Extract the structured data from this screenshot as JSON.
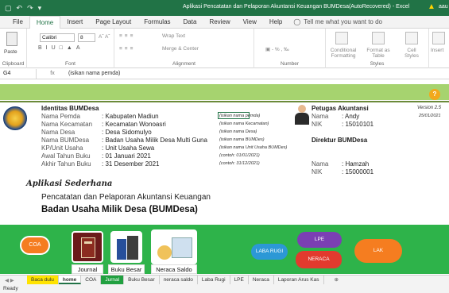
{
  "window": {
    "title": "Aplikasi Pencatatan dan Pelaporan Akuntansi Keuangan BUMDesa(AutoRecovered) - Excel",
    "user": "aau"
  },
  "ribbon_tabs": [
    "File",
    "Home",
    "Insert",
    "Page Layout",
    "Formulas",
    "Data",
    "Review",
    "View",
    "Help"
  ],
  "tell_me": "Tell me what you want to do",
  "ribbon": {
    "paste": "Paste",
    "font_name": "Calibri",
    "font_size": "8",
    "wrap_text": "Wrap Text",
    "merge_center": "Merge & Center",
    "conditional": "Conditional Formatting",
    "format_table": "Format as Table",
    "cell_styles": "Cell Styles",
    "insert": "Insert",
    "groups": [
      "Clipboard",
      "Font",
      "Alignment",
      "Number",
      "Styles"
    ]
  },
  "formula_bar": {
    "cell": "G4",
    "fx": "fx",
    "value": "(isikan nama pemda)"
  },
  "identitas": {
    "heading": "Identitas BUMDesa",
    "rows": [
      {
        "label": "Nama Pemda",
        "value": ": Kabupaten Madiun",
        "hint": "(isikan nama pemda)"
      },
      {
        "label": "Nama Kecamatan",
        "value": ": Kecamatan Wonoasri",
        "hint": "(isikan nama Kecamatan)"
      },
      {
        "label": "Nama Desa",
        "value": ": Desa Sidomulyo",
        "hint": "(isikan nama Desa)"
      },
      {
        "label": "Nama BUMDesa",
        "value": ": Badan Usaha Milik Desa Multi Guna",
        "hint": "(isikan nama BUMDes)"
      },
      {
        "label": "KP/Unit Usaha",
        "value": ": Unit Usaha Sewa",
        "hint": "(isikan nama Unit Usaha BUMDes)"
      },
      {
        "label": "Awal Tahun Buku",
        "value": ": 01 Januari 2021",
        "hint": "(contoh: 01/01/2021)"
      },
      {
        "label": "Akhir Tahun Buku",
        "value": ": 31 Desember 2021",
        "hint": "(contoh: 31/12/2021)"
      }
    ]
  },
  "petugas": {
    "heading": "Petugas Akuntansi",
    "nama_label": "Nama",
    "nama_value": ": Andy",
    "nik_label": "NIK",
    "nik_value": ": 15010101"
  },
  "direktur": {
    "heading": "Direktur BUMDesa",
    "nama_label": "Nama",
    "nama_value": ": Hamzah",
    "nik_label": "NIK",
    "nik_value": ": 15000001"
  },
  "version": {
    "label": "Version 2.5",
    "date": "25/01/2021"
  },
  "help_badge": "?",
  "app": {
    "title": "Aplikasi Sederhana",
    "subtitle1": "Pencatatan dan Pelaporan Akuntansi Keuangan",
    "subtitle2": "Badan Usaha Milik Desa (BUMDesa)"
  },
  "nav": {
    "coa": "COA",
    "journal_icon_text": "Journal",
    "journal": "Journal",
    "buku_besar": "Buku Besar",
    "neraca_saldo": "Neraca Saldo",
    "laba_rugi": "LABA RUGI",
    "lpe": "LPE",
    "neraca": "NERACA",
    "lak": "LAK"
  },
  "sheet_tabs": [
    "Baca dulu",
    "home",
    "COA",
    "Jurnal",
    "Buku Besar",
    "neraca saldo",
    "Laba Rugi",
    "LPE",
    "Neraca",
    "Laporan Arus Kas"
  ],
  "status": "Ready",
  "colors": {
    "excel_green": "#217346",
    "band_green": "#a6d36f",
    "nav_green": "#2eb34a",
    "accent_orange": "#f57d20"
  }
}
